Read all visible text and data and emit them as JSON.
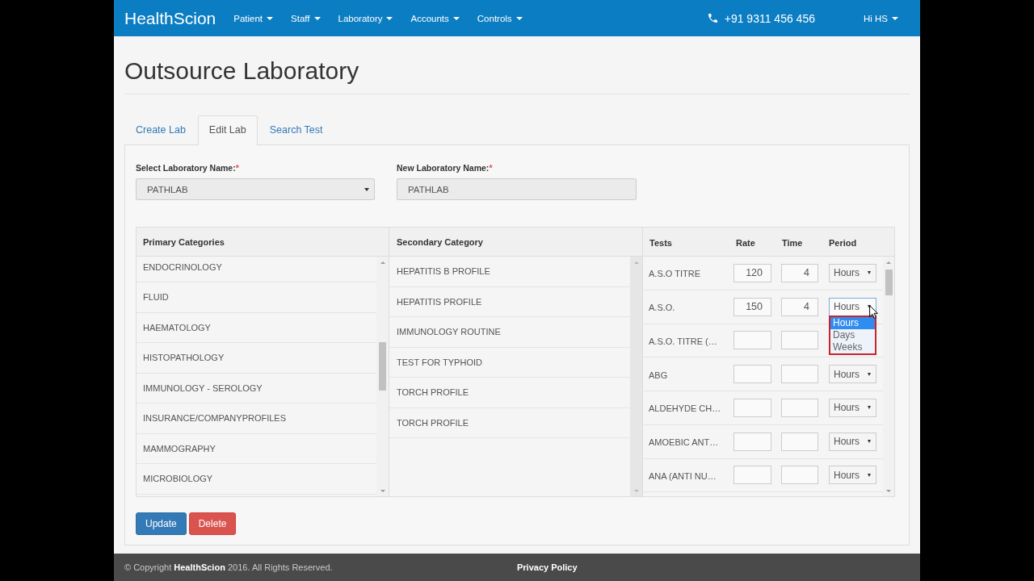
{
  "navbar": {
    "brand": "HealthScion",
    "menus": [
      {
        "label": "Patient"
      },
      {
        "label": "Staff"
      },
      {
        "label": "Laboratory"
      },
      {
        "label": "Accounts"
      },
      {
        "label": "Controls"
      }
    ],
    "phone": "+91 9311 456 456",
    "user": "Hi HS"
  },
  "page_title": "Outsource Laboratory",
  "tabs": [
    {
      "label": "Create Lab",
      "selected": false
    },
    {
      "label": "Edit Lab",
      "selected": true
    },
    {
      "label": "Search Test",
      "selected": false
    }
  ],
  "form": [
    {
      "kind": "select",
      "label": "Select Laboratory Name:",
      "required_mark": "*",
      "value": "PATHLAB"
    },
    {
      "kind": "text",
      "label": "New Laboratory Name:",
      "required_mark": "*",
      "value": "PATHLAB"
    }
  ],
  "primary_categories": {
    "heading": "Primary Categories",
    "items": [
      "ENDOCRINOLOGY",
      "FLUID",
      "HAEMATOLOGY",
      "HISTOPATHOLOGY",
      "IMMUNOLOGY - SEROLOGY",
      "INSURANCE/COMPANYPROFILES",
      "MAMMOGRAPHY",
      "MICROBIOLOGY"
    ]
  },
  "secondary_category": {
    "heading": "Secondary Category",
    "items": [
      "HEPATITIS B PROFILE",
      "HEPATITIS PROFILE",
      "IMMUNOLOGY ROUTINE",
      "TEST FOR TYPHOID",
      "TORCH PROFILE",
      "TORCH PROFILE"
    ]
  },
  "tests": {
    "columns": [
      "Tests",
      "Rate",
      "Time",
      "Period"
    ],
    "rows": [
      {
        "name": "A.S.O TITRE",
        "rate": "120",
        "time": "4",
        "period": {
          "value": "Hours",
          "open": false
        }
      },
      {
        "name": "A.S.O.",
        "rate": "150",
        "time": "4",
        "period": {
          "value": "Hours",
          "open": true,
          "options": [
            {
              "label": "Hours",
              "selected": true
            },
            {
              "label": "Days",
              "selected": false
            },
            {
              "label": "Weeks",
              "selected": false
            }
          ]
        }
      },
      {
        "name": "A.S.O. TITRE (…"
      },
      {
        "name": "ABG",
        "period": {
          "value": "Hours",
          "open": false
        }
      },
      {
        "name": "ALDEHYDE CH…",
        "period": {
          "value": "Hours",
          "open": false
        }
      },
      {
        "name": "AMOEBIC ANT…",
        "period": {
          "value": "Hours",
          "open": false
        }
      },
      {
        "name": "ANA (ANTI NU…",
        "period": {
          "value": "Hours",
          "open": false
        }
      }
    ]
  },
  "buttons": [
    {
      "kind": "primary",
      "label": "Update"
    },
    {
      "kind": "danger",
      "label": "Delete"
    }
  ],
  "footer": {
    "copyright": "© Copyright **HealthScion** 2016. All Rights Reserved.",
    "link": "Privacy Policy"
  }
}
